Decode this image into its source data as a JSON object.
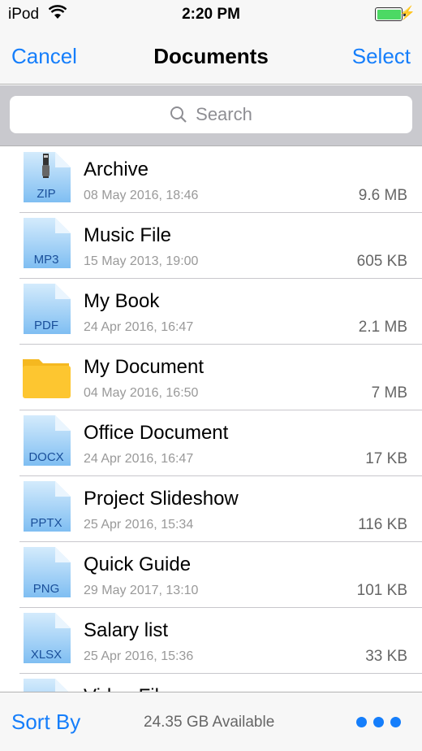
{
  "status": {
    "carrier": "iPod",
    "time": "2:20 PM",
    "battery_level": 1.0,
    "charging": true
  },
  "nav": {
    "cancel": "Cancel",
    "title": "Documents",
    "select": "Select"
  },
  "search": {
    "placeholder": "Search"
  },
  "files": [
    {
      "name": "Archive",
      "date": "08 May 2016, 18:46",
      "size": "9.6 MB",
      "type": "ZIP",
      "icon": "zip-file-icon"
    },
    {
      "name": "Music File",
      "date": "15 May 2013, 19:00",
      "size": "605 KB",
      "type": "MP3",
      "icon": "file-icon"
    },
    {
      "name": "My Book",
      "date": "24 Apr 2016, 16:47",
      "size": "2.1 MB",
      "type": "PDF",
      "icon": "file-icon"
    },
    {
      "name": "My Document",
      "date": "04 May 2016, 16:50",
      "size": "7 MB",
      "type": "",
      "icon": "folder-icon"
    },
    {
      "name": "Office Document",
      "date": "24 Apr 2016, 16:47",
      "size": "17 KB",
      "type": "DOCX",
      "icon": "file-icon"
    },
    {
      "name": "Project Slideshow",
      "date": "25 Apr 2016, 15:34",
      "size": "116 KB",
      "type": "PPTX",
      "icon": "file-icon"
    },
    {
      "name": "Quick Guide",
      "date": "29 May 2017, 13:10",
      "size": "101 KB",
      "type": "PNG",
      "icon": "file-icon"
    },
    {
      "name": "Salary list",
      "date": "25 Apr 2016, 15:36",
      "size": "33 KB",
      "type": "XLSX",
      "icon": "file-icon"
    },
    {
      "name": "Video File",
      "date": "",
      "size": "",
      "type": "",
      "icon": "file-icon"
    }
  ],
  "toolbar": {
    "sort": "Sort By",
    "available": "24.35 GB Available",
    "more_icon": "more-dots-icon"
  },
  "colors": {
    "accent": "#157efb",
    "file_blue": "#8cc8f5",
    "folder": "#fdc630"
  }
}
